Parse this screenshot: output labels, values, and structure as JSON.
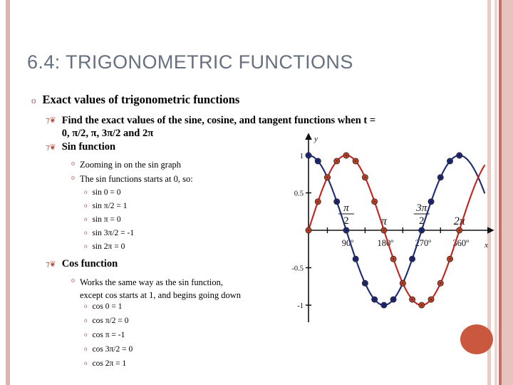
{
  "slide": {
    "title": "6.4: TRIGONOMETRIC FUNCTIONS",
    "title_color": "#67707f",
    "background": "#ffffff"
  },
  "decor": {
    "stripe_colors": [
      "#dcb5b2",
      "#e8cbc7",
      "#eed5d1",
      "#c6706a",
      "#e7c3bd"
    ],
    "blob_color": "#c9583f"
  },
  "bullets": {
    "glyph_level1": "o",
    "glyph_level2": "⁊❦",
    "glyph_level3": "o",
    "glyph_level4": "o",
    "bullet_color": "#b4584a"
  },
  "body": {
    "l1_exact_values": "Exact values of trigonometric functions",
    "l2_find_values": "Find the exact values of the sine, cosine, and tangent functions when t =",
    "l2_find_values_line2": "0, π/2, π, 3π/2 and 2π",
    "l2_sin_function": "Sin function",
    "l3_zooming": "Zooming in on the sin graph",
    "l3_starts_at_zero": "The sin functions starts at 0, so:",
    "sin_values": [
      "sin 0 = 0",
      "sin π/2 = 1",
      "sin π = 0",
      "sin 3π/2 = -1",
      "sin 2π = 0"
    ],
    "l2_cos_function": "Cos function",
    "l3_cos_note_line1": "Works the same way as the sin function,",
    "l3_cos_note_line2": "except cos starts at 1, and begins going down",
    "cos_values": [
      "cos 0 = 1",
      "cos π/2 = 0",
      "cos π = -1",
      "cos 3π/2 = 0",
      "cos 2π = 1"
    ]
  },
  "chart_data": {
    "type": "line",
    "title": "",
    "xlabel": "x",
    "ylabel": "y",
    "xlim": [
      0,
      7.33
    ],
    "ylim": [
      -1.15,
      1.15
    ],
    "grid": false,
    "legend": "none",
    "x_tick_labels": [
      "π/2",
      "π",
      "3π/2",
      "2π"
    ],
    "x_tick_values": [
      1.5708,
      3.1416,
      4.7124,
      6.2832
    ],
    "x_tick_degree_labels": [
      "90º",
      "180º",
      "270º",
      "360º"
    ],
    "y_tick_labels": [
      "1",
      "0.5",
      "-0.5",
      "-1"
    ],
    "y_tick_values": [
      1,
      0.5,
      -0.5,
      -1
    ],
    "series": [
      {
        "name": "cosine",
        "color": "#1c2a78",
        "marker_color": "#1c2a78",
        "x": [
          0,
          0.3927,
          0.7854,
          1.1781,
          1.5708,
          1.9635,
          2.3562,
          2.7489,
          3.1416,
          3.5343,
          3.927,
          4.3197,
          4.7124,
          5.1051,
          5.4978,
          5.8905,
          6.2832
        ],
        "values": [
          1,
          0.924,
          0.707,
          0.383,
          0,
          -0.383,
          -0.707,
          -0.924,
          -1,
          -0.924,
          -0.707,
          -0.383,
          0,
          0.383,
          0.707,
          0.924,
          1
        ]
      },
      {
        "name": "sine",
        "color": "#c4231e",
        "marker_color": "#b5432c",
        "x": [
          0,
          0.3927,
          0.7854,
          1.1781,
          1.5708,
          1.9635,
          2.3562,
          2.7489,
          3.1416,
          3.5343,
          3.927,
          4.3197,
          4.7124,
          5.1051,
          5.4978,
          5.8905,
          6.2832
        ],
        "values": [
          0,
          0.383,
          0.707,
          0.924,
          1,
          0.924,
          0.707,
          0.383,
          0,
          -0.383,
          -0.707,
          -0.924,
          -1,
          -0.924,
          -0.707,
          -0.383,
          0
        ]
      }
    ]
  }
}
